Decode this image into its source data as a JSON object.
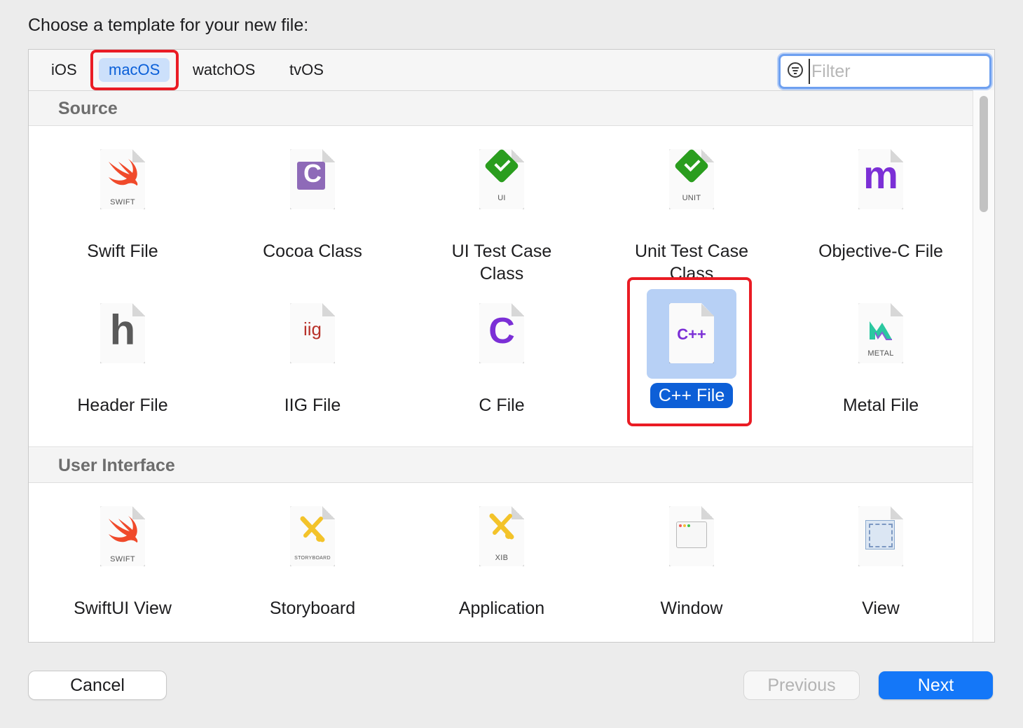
{
  "dialog": {
    "prompt": "Choose a template for your new file:"
  },
  "tabs": [
    {
      "label": "iOS",
      "selected": false
    },
    {
      "label": "macOS",
      "selected": true
    },
    {
      "label": "watchOS",
      "selected": false
    },
    {
      "label": "tvOS",
      "selected": false
    }
  ],
  "filter": {
    "placeholder": "Filter",
    "value": ""
  },
  "sections": [
    {
      "title": "Source",
      "items": [
        {
          "label": "Swift File",
          "icon": "swift-file-icon",
          "tag": "SWIFT"
        },
        {
          "label": "Cocoa Class",
          "icon": "cocoa-class-icon",
          "glyph": "C"
        },
        {
          "label": "UI Test Case Class",
          "icon": "ui-test-icon",
          "tag": "UI"
        },
        {
          "label": "Unit Test Case Class",
          "icon": "unit-test-icon",
          "tag": "UNIT"
        },
        {
          "label": "Objective-C File",
          "icon": "objective-c-file-icon",
          "glyph": "m"
        },
        {
          "label": "Header File",
          "icon": "header-file-icon",
          "glyph": "h"
        },
        {
          "label": "IIG File",
          "icon": "iig-file-icon",
          "glyph": "iig"
        },
        {
          "label": "C File",
          "icon": "c-file-icon",
          "glyph": "C"
        },
        {
          "label": "C++ File",
          "icon": "cpp-file-icon",
          "glyph": "C++",
          "selected": true
        },
        {
          "label": "Metal File",
          "icon": "metal-file-icon",
          "tag": "METAL"
        }
      ]
    },
    {
      "title": "User Interface",
      "items": [
        {
          "label": "SwiftUI View",
          "icon": "swift-file-icon",
          "tag": "SWIFT"
        },
        {
          "label": "Storyboard",
          "icon": "storyboard-icon",
          "tag": "STORYBOARD"
        },
        {
          "label": "Application",
          "icon": "xib-icon",
          "tag": "XIB"
        },
        {
          "label": "Window",
          "icon": "window-icon"
        },
        {
          "label": "View",
          "icon": "view-icon"
        }
      ]
    }
  ],
  "buttons": {
    "cancel": "Cancel",
    "previous": "Previous",
    "next": "Next"
  },
  "colors": {
    "accent": "#1477f8",
    "selection": "#0d5fd7",
    "highlight": "#ea1c24"
  }
}
